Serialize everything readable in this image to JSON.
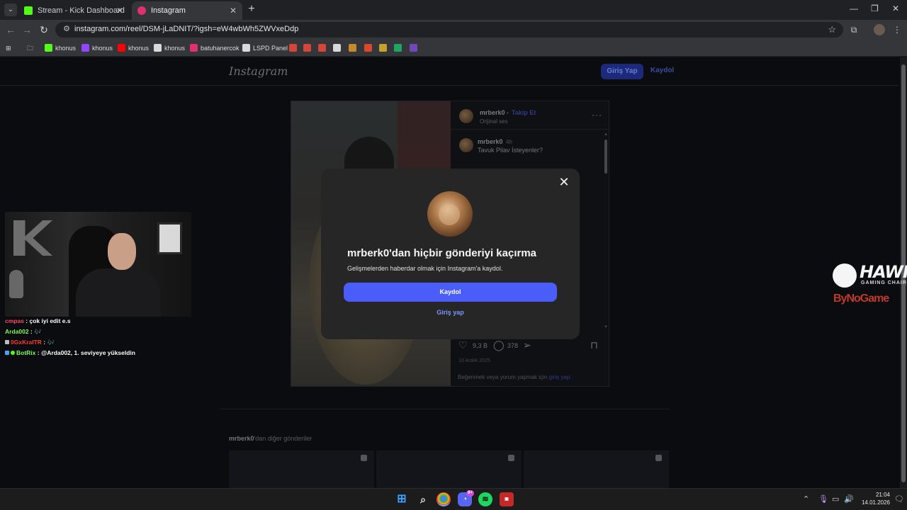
{
  "browser": {
    "tabs": [
      {
        "title": "Stream - Kick Dashboard",
        "favicon_color": "#53fc18",
        "active": false
      },
      {
        "title": "Instagram",
        "favicon_color": "#e1306c",
        "active": true
      }
    ],
    "url": "instagram.com/reel/DSM-jLaDNIT/?igsh=eW4wbWh5ZWVxeDdp",
    "bookmarks": [
      {
        "label": "khonus",
        "icon_color": "#53fc18"
      },
      {
        "label": "khonus",
        "icon_color": "#9146ff"
      },
      {
        "label": "khonus",
        "icon_color": "#ff0000"
      },
      {
        "label": "khonus",
        "icon_color": "#d9d9d9"
      },
      {
        "label": "batuhanercok",
        "icon_color": "#e1306c"
      },
      {
        "label": "LSPD Panel",
        "icon_color": "#d9d9d9"
      }
    ]
  },
  "instagram": {
    "logo": "Instagram",
    "login_button": "Giriş Yap",
    "signup_link": "Kaydol",
    "post": {
      "username": "mrberk0",
      "follow_label": "Takip Et",
      "audio": "Orijinal ses",
      "comment_user": "mrberk0",
      "comment_time": "4h",
      "comment_text": "Tavuk Pilav İsteyenler?",
      "likes": "9,3 B",
      "comments": "378",
      "date": "13 Aralık 2025",
      "comment_prompt": "Beğenmek veya yorum yapmak için",
      "comment_prompt_link": "giriş yap."
    },
    "more_posts_user": "mrberk0",
    "more_posts_suffix": "'dan diğer gönderiler"
  },
  "modal": {
    "title": "mrberk0'dan hiçbir gönderiyi kaçırma",
    "subtitle": "Gelişmelerden haberdar olmak için Instagram'a kaydol.",
    "signup_button": "Kaydol",
    "login_link": "Giriş yap"
  },
  "stream_chat": [
    {
      "user": "cmpas",
      "user_color": "#ff4d6d",
      "message": "çok iyi edit e.s"
    },
    {
      "user": "Arda002",
      "user_color": "#7dff5a",
      "message": "🎶"
    },
    {
      "user": "0GxKralTR",
      "user_color": "#ff3b3b",
      "message": "🎶"
    },
    {
      "user": "BotRix",
      "user_color": "#7dff5a",
      "message": "@Arda002, 1. seviyeye yükseldin"
    }
  ],
  "sponsor": {
    "name": "HAWK",
    "tagline": "GAMING CHAIR",
    "partner": "ByNoGame"
  },
  "taskbar": {
    "discord_badge": "9+",
    "time": "21:04",
    "date": "14.01.2026"
  },
  "colors": {
    "accent_blue": "#4a5df9",
    "link_blue": "#7d93ff"
  }
}
